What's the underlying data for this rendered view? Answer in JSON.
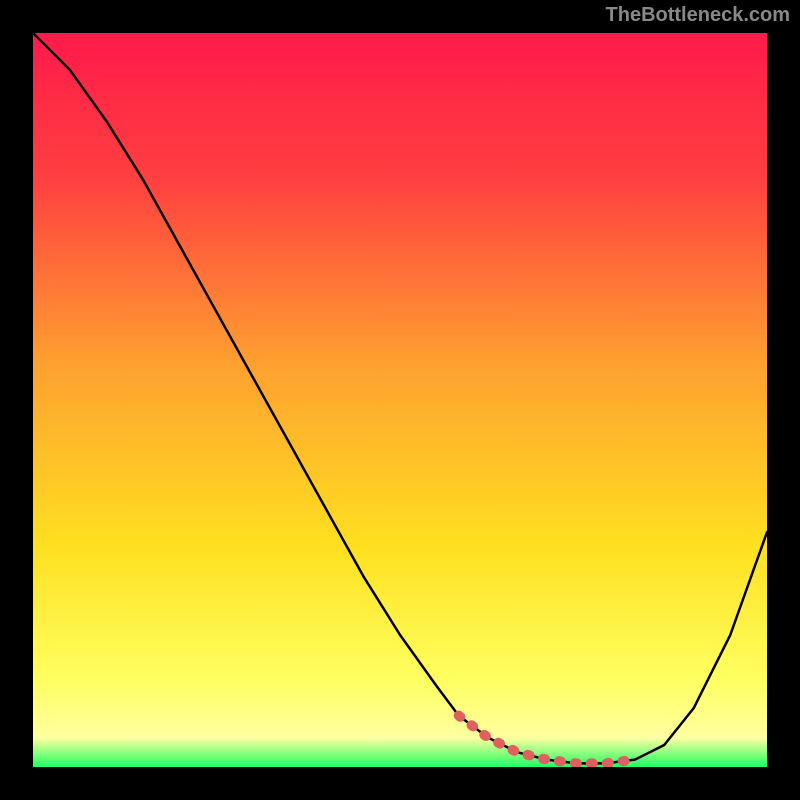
{
  "watermark": "TheBottleneck.com",
  "chart_data": {
    "type": "line",
    "title": "",
    "xlabel": "",
    "ylabel": "",
    "xlim": [
      0,
      100
    ],
    "ylim": [
      0,
      100
    ],
    "gradient_stops": [
      {
        "offset": 0,
        "color": "#ff1a4a"
      },
      {
        "offset": 20,
        "color": "#ff4040"
      },
      {
        "offset": 45,
        "color": "#ffa030"
      },
      {
        "offset": 70,
        "color": "#ffe020"
      },
      {
        "offset": 88,
        "color": "#ffff60"
      },
      {
        "offset": 96,
        "color": "#ffffa0"
      },
      {
        "offset": 100,
        "color": "#20ff60"
      }
    ],
    "series": [
      {
        "name": "curve",
        "color": "#000000",
        "x": [
          0,
          5,
          10,
          15,
          20,
          25,
          30,
          35,
          40,
          45,
          50,
          55,
          58,
          62,
          66,
          70,
          74,
          78,
          82,
          86,
          90,
          95,
          100
        ],
        "y": [
          100,
          95,
          88,
          80,
          71,
          62,
          53,
          44,
          35,
          26,
          18,
          11,
          7,
          4,
          2,
          1,
          0.5,
          0.5,
          1,
          3,
          8,
          18,
          32
        ]
      },
      {
        "name": "highlight",
        "color": "#e06060",
        "style": "dotted-thick",
        "x": [
          58,
          62,
          66,
          70,
          74,
          78,
          82
        ],
        "y": [
          7,
          4,
          2,
          1,
          0.5,
          0.5,
          1
        ]
      }
    ]
  }
}
